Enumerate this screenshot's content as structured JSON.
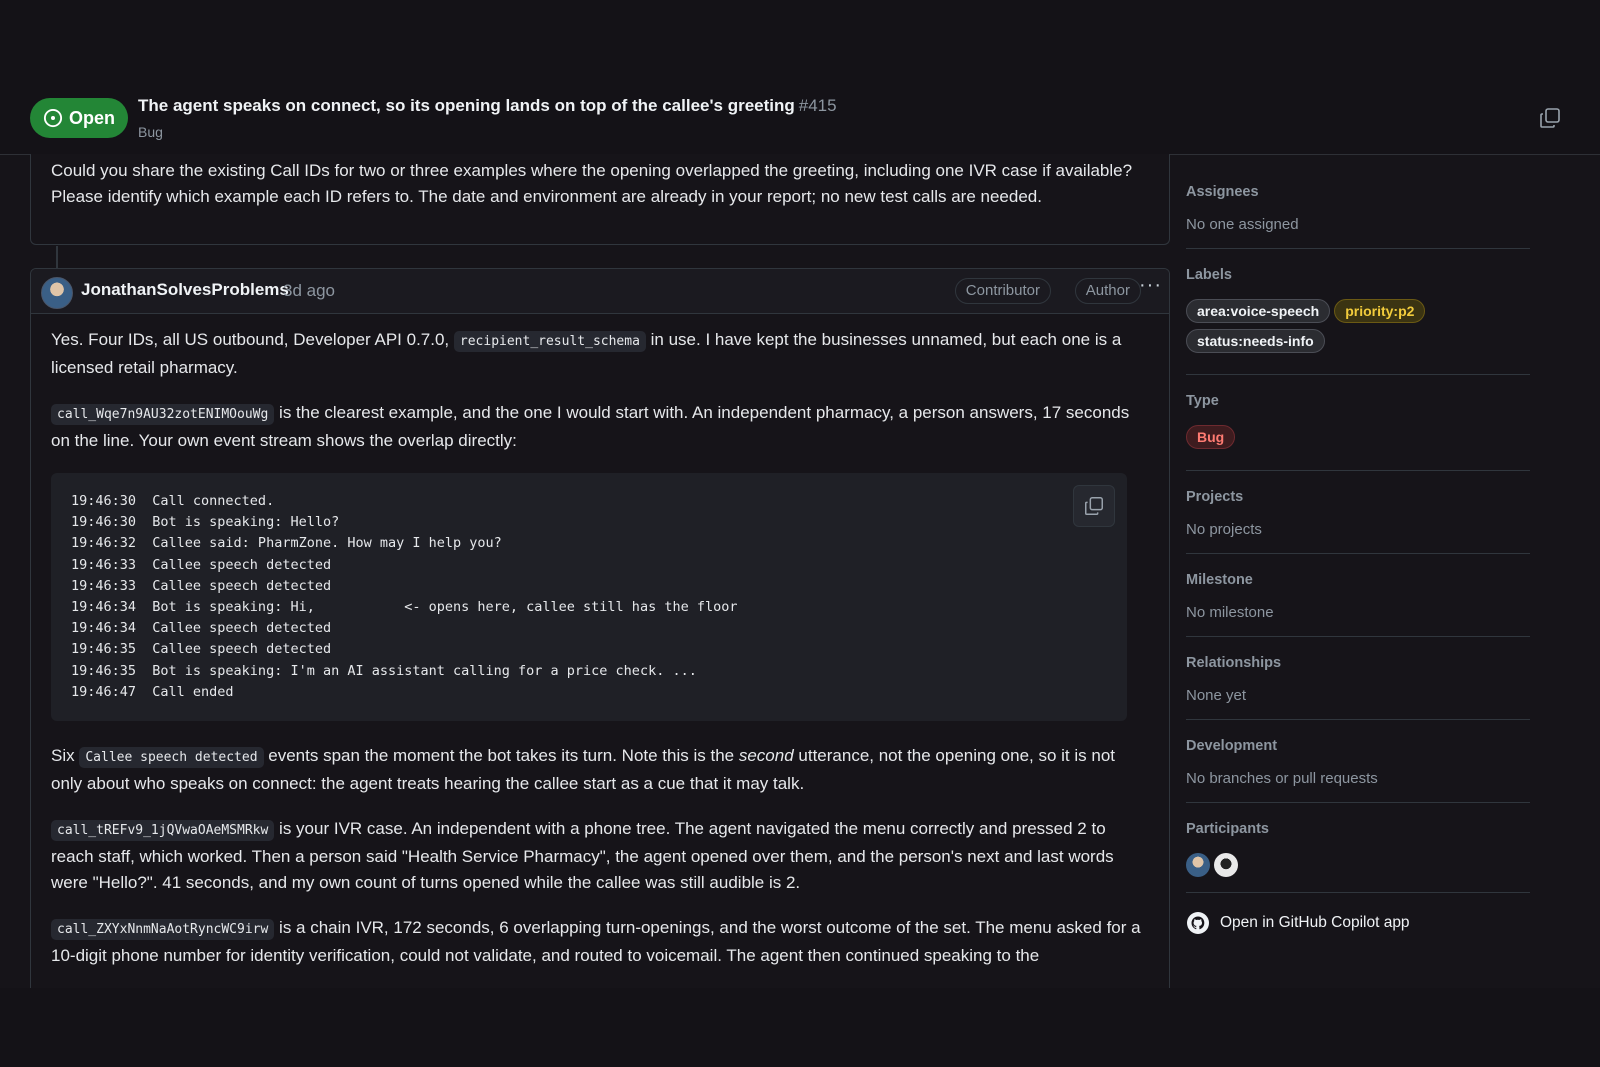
{
  "header": {
    "state_label": "Open",
    "title": "The agent speaks on connect, so its opening lands on top of the callee's greeting",
    "number": "#415",
    "type_sub": "Bug"
  },
  "previous_comment": {
    "text": "Could you share the existing Call IDs for two or three examples where the opening overlapped the greeting, including one IVR case if available? Please identify which example each ID refers to. The date and environment are already in your report; no new test calls are needed."
  },
  "comment": {
    "author": "JonathanSolvesProblems",
    "time": "3d ago",
    "badge_contributor": "Contributor",
    "badge_author": "Author",
    "p1_a": "Yes. Four IDs, all US outbound, Developer API 0.7.0, ",
    "p1_code": "recipient_result_schema",
    "p1_b": " in use. I have kept the businesses unnamed, but each one is a licensed retail pharmacy.",
    "p2_code": "call_Wqe7n9AU32zotENIMOouWg",
    "p2_b": " is the clearest example, and the one I would start with. An independent pharmacy, a person answers, 17 seconds on the line. Your own event stream shows the overlap directly:",
    "code_block": "19:46:30  Call connected.\n19:46:30  Bot is speaking: Hello?\n19:46:32  Callee said: PharmZone. How may I help you?\n19:46:33  Callee speech detected\n19:46:33  Callee speech detected\n19:46:34  Bot is speaking: Hi,           <- opens here, callee still has the floor\n19:46:34  Callee speech detected\n19:46:35  Callee speech detected\n19:46:35  Bot is speaking: I'm an AI assistant calling for a price check. ...\n19:46:47  Call ended",
    "p3_a": "Six ",
    "p3_code": "Callee speech detected",
    "p3_b": " events span the moment the bot takes its turn. Note this is the ",
    "p3_em": "second",
    "p3_c": " utterance, not the opening one, so it is not only about who speaks on connect: the agent treats hearing the callee start as a cue that it may talk.",
    "p4_code": "call_tREFv9_1jQVwaOAeMSMRkw",
    "p4_b": " is your IVR case. An independent with a phone tree. The agent navigated the menu correctly and pressed 2 to reach staff, which worked. Then a person said \"Health Service Pharmacy\", the agent opened over them, and the person's next and last words were \"Hello?\". 41 seconds, and my own count of turns opened while the callee was still audible is 2.",
    "p5_code": "call_ZXYxNnmNaAotRyncWC9irw",
    "p5_b": " is a chain IVR, 172 seconds, 6 overlapping turn-openings, and the worst outcome of the set. The menu asked for a 10-digit phone number for identity verification, could not validate, and routed to voicemail. The agent then continued speaking to the"
  },
  "sidebar": {
    "assignees_title": "Assignees",
    "assignees_value": "No one assigned",
    "labels_title": "Labels",
    "label_area": "area:voice-speech",
    "label_priority": "priority:p2",
    "label_status": "status:needs-info",
    "type_title": "Type",
    "type_value": "Bug",
    "projects_title": "Projects",
    "projects_value": "No projects",
    "milestone_title": "Milestone",
    "milestone_value": "No milestone",
    "relationships_title": "Relationships",
    "relationships_value": "None yet",
    "development_title": "Development",
    "development_value": "No branches or pull requests",
    "participants_title": "Participants",
    "copilot_label": "Open in GitHub Copilot app"
  },
  "colors": {
    "open_green": "#238636",
    "priority_yellow": "#f2cc3c",
    "bug_red": "#ff7b72"
  }
}
